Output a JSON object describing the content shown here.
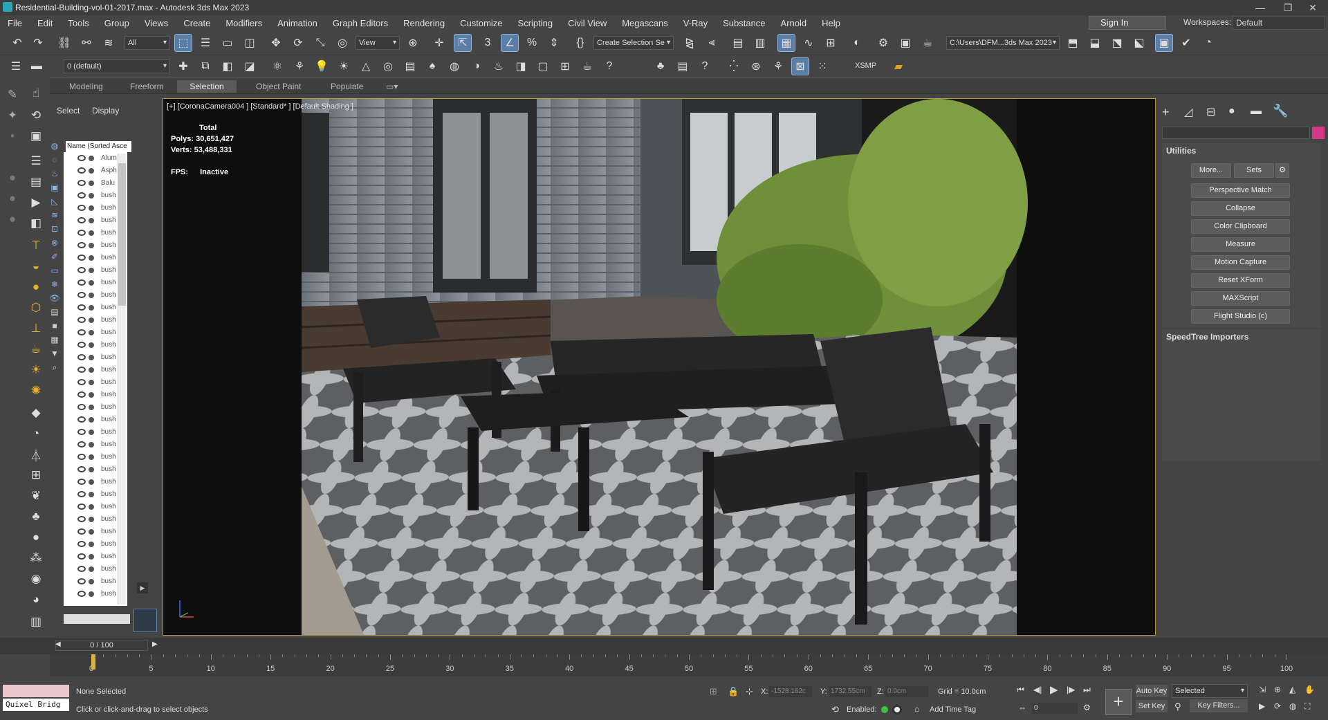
{
  "window": {
    "title": "Residential-Building-vol-01-2017.max - Autodesk 3ds Max 2023",
    "minimize": "—",
    "restore": "❐",
    "close": "✕"
  },
  "menu": [
    "File",
    "Edit",
    "Tools",
    "Group",
    "Views",
    "Create",
    "Modifiers",
    "Animation",
    "Graph Editors",
    "Rendering",
    "Customize",
    "Scripting",
    "Civil View",
    "Megascans",
    "V-Ray",
    "Substance",
    "Arnold",
    "Help"
  ],
  "account": {
    "sign_in": "Sign In",
    "workspaces_label": "Workspaces:",
    "workspace": "Default"
  },
  "toolbar1": {
    "filter": "All",
    "ref_coord": "View",
    "selection_set": "Create Selection Se",
    "project_path": "C:\\Users\\DFM...3ds Max 2023"
  },
  "toolbar2": {
    "layer": "0 (default)",
    "xsmp": "XSMP"
  },
  "ribbon_tabs": [
    "Modeling",
    "Freeform",
    "Selection",
    "Object Paint",
    "Populate"
  ],
  "scene_explorer": {
    "tab_select": "Select",
    "tab_display": "Display",
    "column": "Name (Sorted Asce",
    "rows": [
      "Alum",
      "Asph",
      "Balu",
      "bush",
      "bush",
      "bush",
      "bush",
      "bush",
      "bush",
      "bush",
      "bush",
      "bush",
      "bush",
      "bush",
      "bush",
      "bush",
      "bush",
      "bush",
      "bush",
      "bush",
      "bush",
      "bush",
      "bush",
      "bush",
      "bush",
      "bush",
      "bush",
      "bush",
      "bush",
      "bush",
      "bush",
      "bush",
      "bush",
      "bush",
      "bush",
      "bush"
    ]
  },
  "viewport": {
    "label": "[+] [CoronaCamera004 ] [Standard* ] [Default Shading ]",
    "stats": {
      "total_label": "Total",
      "polys_label": "Polys:",
      "polys": "30,651,427",
      "verts_label": "Verts:",
      "verts": "53,488,331",
      "fps_label": "FPS:",
      "fps": "Inactive"
    }
  },
  "command_panel": {
    "rollout_utilities": "Utilities",
    "more": "More...",
    "sets": "Sets",
    "buttons": [
      "Perspective Match",
      "Collapse",
      "Color Clipboard",
      "Measure",
      "Motion Capture",
      "Reset XForm",
      "MAXScript",
      "Flight Studio (c)"
    ],
    "rollout_speedtree": "SpeedTree Importers"
  },
  "timeline": {
    "frame": "0 / 100",
    "ticks": [
      "0",
      "5",
      "10",
      "15",
      "20",
      "25",
      "30",
      "35",
      "40",
      "45",
      "50",
      "55",
      "60",
      "65",
      "70",
      "75",
      "80",
      "85",
      "90",
      "95",
      "100"
    ]
  },
  "status": {
    "quixel": "Quixel Bridg",
    "selection": "None Selected",
    "prompt": "Click or click-and-drag to select objects",
    "x_label": "X:",
    "x": "-1528.162c",
    "y_label": "Y:",
    "y": "1732.55cm",
    "z_label": "Z:",
    "z": "0.0cm",
    "grid": "Grid = 10.0cm",
    "enabled": "Enabled:",
    "add_time_tag": "Add Time Tag",
    "auto_key": "Auto Key",
    "set_key": "Set Key",
    "key_mode": "Selected",
    "key_filters": "Key Filters...",
    "current_frame": "0"
  }
}
